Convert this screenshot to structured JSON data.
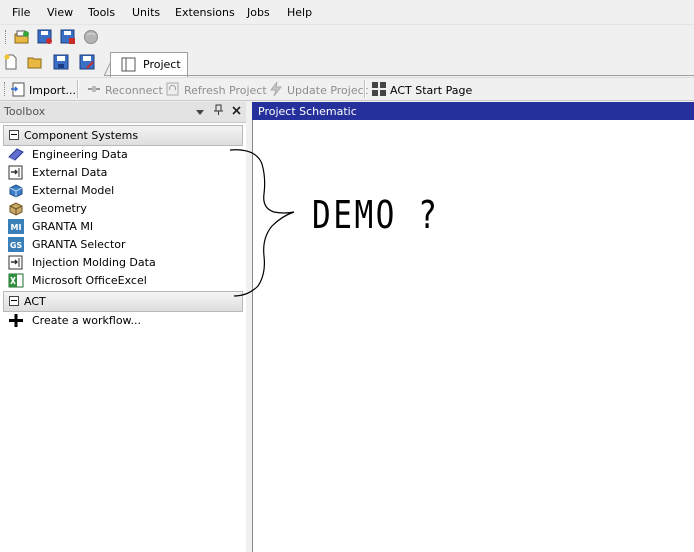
{
  "menu": {
    "file": "File",
    "view": "View",
    "tools": "Tools",
    "units": "Units",
    "extensions": "Extensions",
    "jobs": "Jobs",
    "help": "Help"
  },
  "tabs": {
    "project": "Project"
  },
  "toolbar": {
    "import": "Import...",
    "reconnect": "Reconnect",
    "refresh_project": "Refresh Project",
    "update_project": "Update Project",
    "act_start_page": "ACT Start Page"
  },
  "toolbox": {
    "title": "Toolbox",
    "sections": [
      {
        "label": "Component Systems",
        "items": [
          {
            "label": "Engineering Data",
            "icon": "engineering-data-icon"
          },
          {
            "label": "External Data",
            "icon": "external-data-icon"
          },
          {
            "label": "External Model",
            "icon": "external-model-icon"
          },
          {
            "label": "Geometry",
            "icon": "geometry-icon"
          },
          {
            "label": "GRANTA MI",
            "icon": "granta-mi-icon",
            "badge": "MI"
          },
          {
            "label": "GRANTA Selector",
            "icon": "granta-selector-icon",
            "badge": "GS"
          },
          {
            "label": "Injection Molding Data",
            "icon": "injection-molding-icon"
          },
          {
            "label": "Microsoft OfficeExcel",
            "icon": "excel-icon"
          }
        ]
      },
      {
        "label": "ACT",
        "items": [
          {
            "label": "Create a workflow...",
            "icon": "plus-icon"
          }
        ]
      }
    ]
  },
  "schematic": {
    "title": "Project Schematic",
    "annotation": "DEMO ?"
  },
  "colors": {
    "header_blue": "#26309c",
    "panel_bg": "#f0f0f0"
  }
}
